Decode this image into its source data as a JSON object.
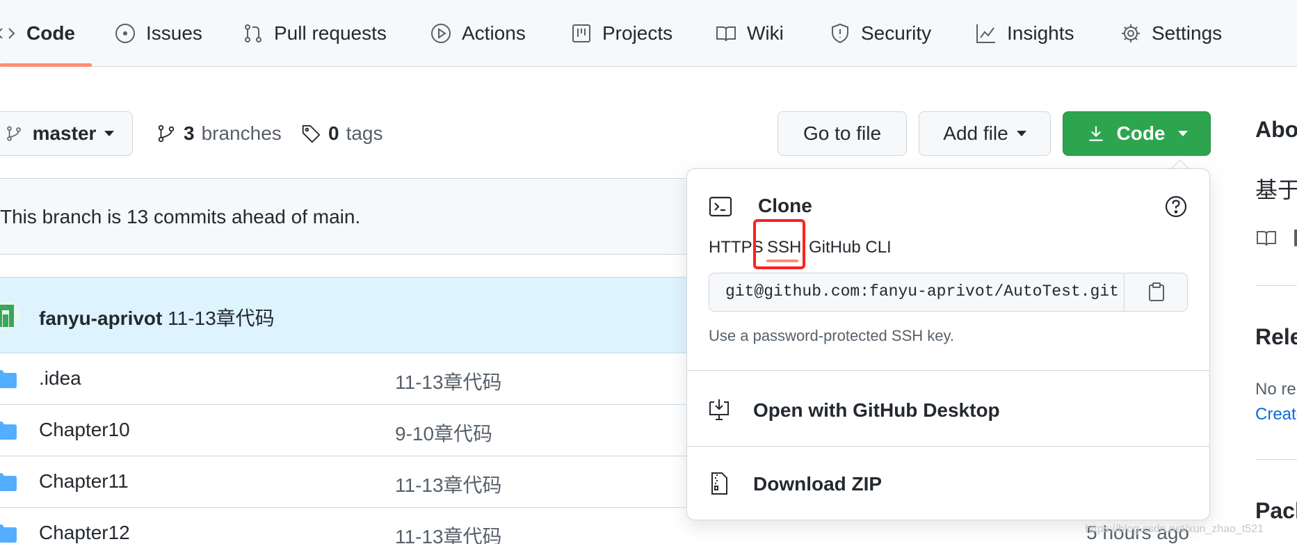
{
  "nav": {
    "tabs": [
      {
        "label": "Code",
        "icon": "code-icon"
      },
      {
        "label": "Issues",
        "icon": "issue-icon"
      },
      {
        "label": "Pull requests",
        "icon": "pull-request-icon"
      },
      {
        "label": "Actions",
        "icon": "play-icon"
      },
      {
        "label": "Projects",
        "icon": "project-icon"
      },
      {
        "label": "Wiki",
        "icon": "book-icon"
      },
      {
        "label": "Security",
        "icon": "shield-icon"
      },
      {
        "label": "Insights",
        "icon": "graph-icon"
      },
      {
        "label": "Settings",
        "icon": "gear-icon"
      }
    ],
    "active_tab": "Code"
  },
  "toolbar": {
    "branch": "master",
    "branches_count": "3",
    "branches_label": "branches",
    "tags_count": "0",
    "tags_label": "tags",
    "go_to_file": "Go to file",
    "add_file": "Add file",
    "code": "Code"
  },
  "ahead_message": "This branch is 13 commits ahead of main.",
  "latest_commit": {
    "author": "fanyu-aprivot",
    "message": "11-13章代码"
  },
  "files": [
    {
      "name": ".idea",
      "message": "11-13章代码",
      "time": ""
    },
    {
      "name": "Chapter10",
      "message": "9-10章代码",
      "time": ""
    },
    {
      "name": "Chapter11",
      "message": "11-13章代码",
      "time": ""
    },
    {
      "name": "Chapter12",
      "message": "11-13章代码",
      "time": "5 hours ago"
    }
  ],
  "clone_dropdown": {
    "title": "Clone",
    "tabs": [
      "HTTPS",
      "SSH",
      "GitHub CLI"
    ],
    "active_tab": "SSH",
    "url": "git@github.com:fanyu-aprivot/AutoTest.git",
    "hint": "Use a password-protected SSH key.",
    "open_desktop": "Open with GitHub Desktop",
    "download_zip": "Download ZIP"
  },
  "sidebar": {
    "about": "Abo",
    "desc": "基于",
    "releases": "Rele",
    "no_releases": "No re",
    "create": "Create",
    "packages": "Pack"
  },
  "watermark": "https://blog.csdn.net/xun_zhao_t521",
  "colors": {
    "accent_green": "#2da44e",
    "tab_underline": "#fd8c73",
    "highlight": "#ff1f1f",
    "link": "#0969da"
  }
}
